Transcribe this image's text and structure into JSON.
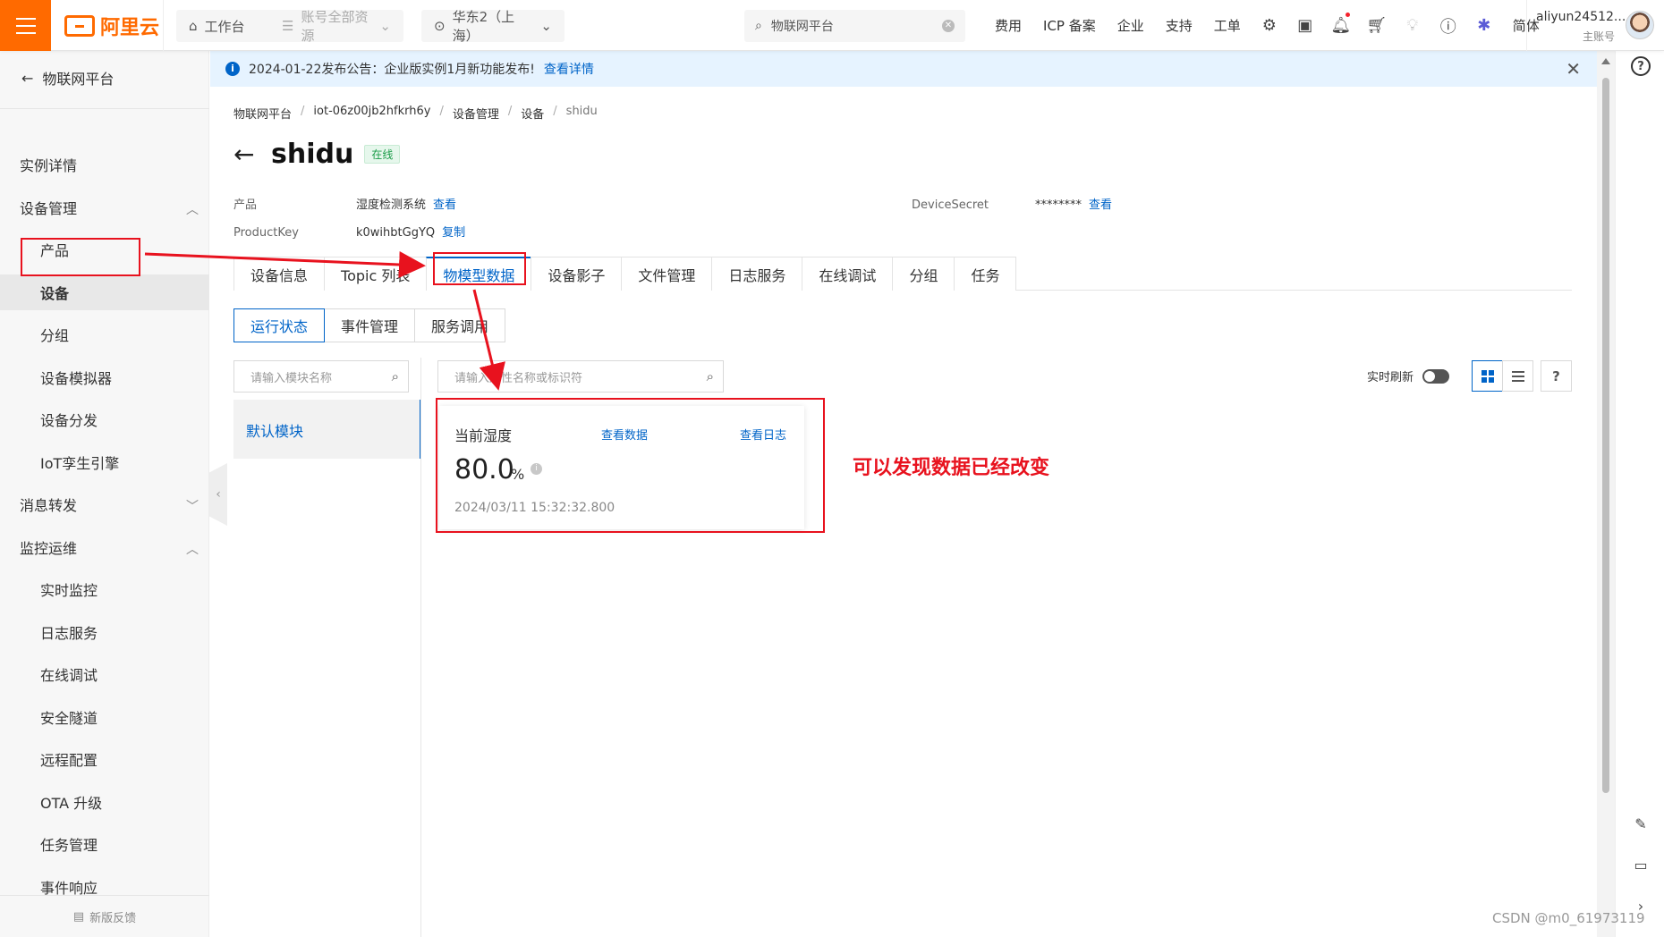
{
  "topbar": {
    "logo_text": "阿里云",
    "workbench": "工作台",
    "account_resources": "账号全部资源",
    "region": "华东2（上海）",
    "search_value": "物联网平台",
    "nav": [
      "费用",
      "ICP 备案",
      "企业",
      "支持",
      "工单"
    ],
    "lang": "简体",
    "user_name": "aliyun24512...",
    "user_sub": "主账号"
  },
  "sidebar": {
    "title": "物联网平台",
    "items": [
      {
        "label": "实例详情",
        "level": 1
      },
      {
        "label": "设备管理",
        "level": 1,
        "chev": "up"
      },
      {
        "label": "产品",
        "level": 2
      },
      {
        "label": "设备",
        "level": 2,
        "active": true
      },
      {
        "label": "分组",
        "level": 2
      },
      {
        "label": "设备模拟器",
        "level": 2
      },
      {
        "label": "设备分发",
        "level": 2
      },
      {
        "label": "IoT孪生引擎",
        "level": 2
      },
      {
        "label": "消息转发",
        "level": 1,
        "chev": "down"
      },
      {
        "label": "监控运维",
        "level": 1,
        "chev": "up"
      },
      {
        "label": "实时监控",
        "level": 2
      },
      {
        "label": "日志服务",
        "level": 2
      },
      {
        "label": "在线调试",
        "level": 2
      },
      {
        "label": "安全隧道",
        "level": 2
      },
      {
        "label": "远程配置",
        "level": 2
      },
      {
        "label": "OTA 升级",
        "level": 2
      },
      {
        "label": "任务管理",
        "level": 2
      },
      {
        "label": "事件响应",
        "level": 2
      }
    ],
    "feedback": "新版反馈"
  },
  "notice": {
    "text": "2024-01-22发布公告：企业版实例1月新功能发布!",
    "link": "查看详情"
  },
  "breadcrumb": [
    "物联网平台",
    "iot-06z00jb2hfkrh6y",
    "设备管理",
    "设备",
    "shidu"
  ],
  "device": {
    "name": "shidu",
    "status": "在线",
    "product_label": "产品",
    "product_value": "湿度检测系统",
    "product_link": "查看",
    "productkey_label": "ProductKey",
    "productkey_value": "k0wihbtGgYQ",
    "productkey_link": "复制",
    "secret_label": "DeviceSecret",
    "secret_value": "********",
    "secret_link": "查看"
  },
  "tabs": [
    "设备信息",
    "Topic 列表",
    "物模型数据",
    "设备影子",
    "文件管理",
    "日志服务",
    "在线调试",
    "分组",
    "任务"
  ],
  "active_tab": 2,
  "subtabs": [
    "运行状态",
    "事件管理",
    "服务调用"
  ],
  "active_subtab": 0,
  "module_search_placeholder": "请输入模块名称",
  "property_search_placeholder": "请输入属性名称或标识符",
  "module_default": "默认模块",
  "realtime_label": "实时刷新",
  "help_label": "?",
  "property_card": {
    "title": "当前湿度",
    "view_data": "查看数据",
    "view_log": "查看日志",
    "value": "80.0",
    "unit": "%",
    "timestamp": "2024/03/11 15:32:32.800"
  },
  "annotation": "可以发现数据已经改变",
  "watermark": "CSDN @m0_61973119",
  "colors": {
    "accent": "#ff6a00",
    "link": "#0064c8",
    "annot": "#e8121e",
    "online": "#1a9c48"
  }
}
